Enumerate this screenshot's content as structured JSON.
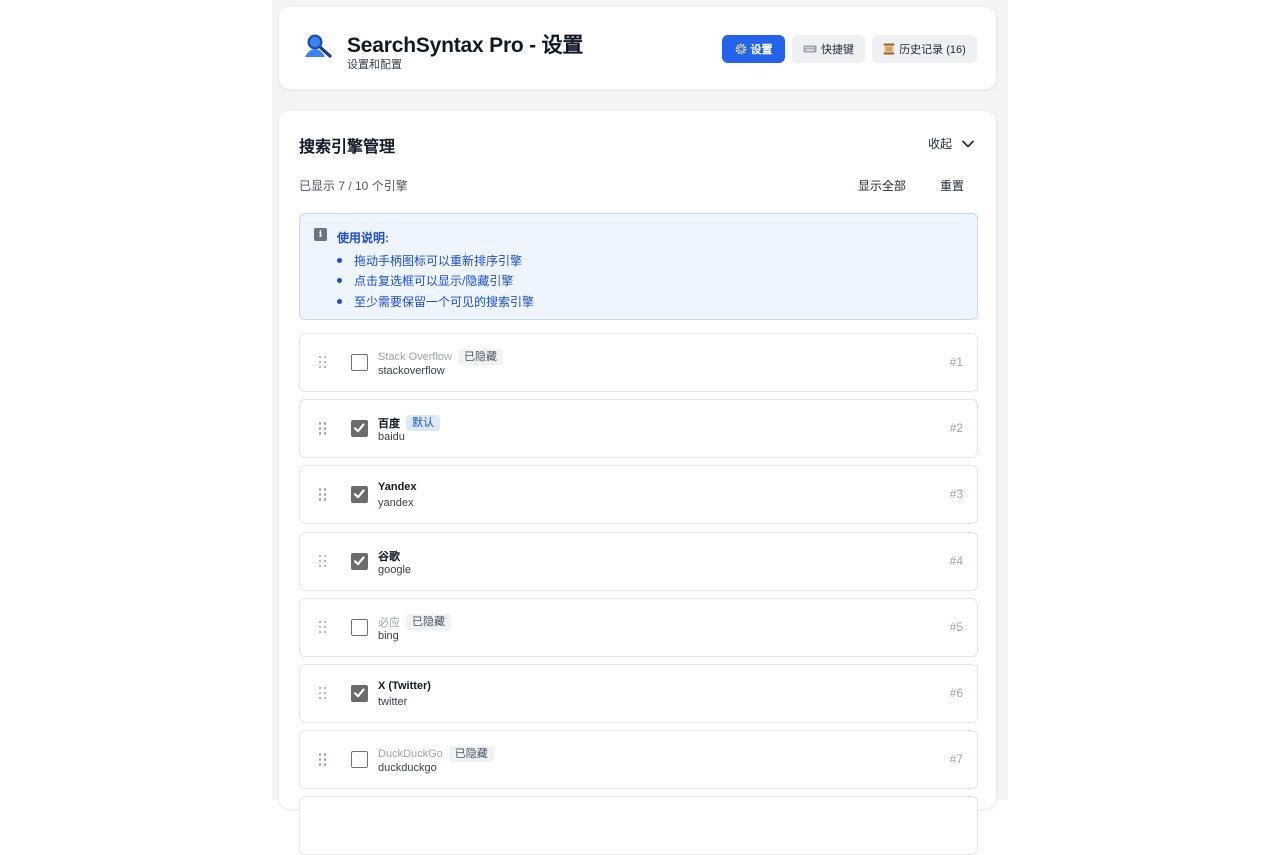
{
  "header": {
    "title": "SearchSyntax Pro - 设置",
    "subtitle": "设置和配置",
    "icon": "search-user-icon",
    "accent_color": "#2563eb",
    "buttons": [
      {
        "label": "设置",
        "icon": "gear-icon",
        "active": true
      },
      {
        "label": "快捷键",
        "icon": "keyboard-icon",
        "active": false
      },
      {
        "label": "历史记录 (16)",
        "icon": "scroll-icon",
        "active": false
      }
    ]
  },
  "engines_section": {
    "title": "搜索引擎管理",
    "collapse_label": "收起",
    "count_text": "已显示 7 / 10 个引擎",
    "show_all_label": "显示全部",
    "reset_label": "重置",
    "info": {
      "title": "使用说明:",
      "items": [
        "拖动手柄图标可以重新排序引擎",
        "点击复选框可以显示/隐藏引擎",
        "至少需要保留一个可见的搜索引擎"
      ]
    },
    "engines": [
      {
        "name": "Stack Overflow",
        "key": "stackoverflow",
        "badge": "已隐藏",
        "checked": false,
        "index": "#1"
      },
      {
        "name": "百度",
        "key": "baidu",
        "badge": "默认",
        "checked": true,
        "index": "#2"
      },
      {
        "name": "Yandex",
        "key": "yandex",
        "badge": "",
        "checked": true,
        "index": "#3"
      },
      {
        "name": "谷歌",
        "key": "google",
        "badge": "",
        "checked": true,
        "index": "#4"
      },
      {
        "name": "必应",
        "key": "bing",
        "badge": "已隐藏",
        "checked": false,
        "index": "#5"
      },
      {
        "name": "X (Twitter)",
        "key": "twitter",
        "badge": "",
        "checked": true,
        "index": "#6"
      },
      {
        "name": "DuckDuckGo",
        "key": "duckduckgo",
        "badge": "已隐藏",
        "checked": false,
        "index": "#7"
      }
    ]
  }
}
